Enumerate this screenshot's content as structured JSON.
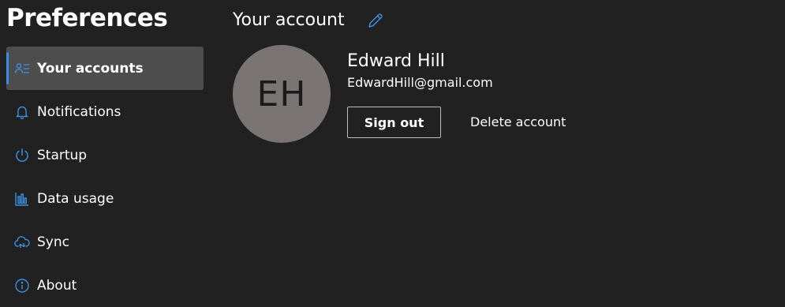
{
  "app": {
    "title": "Preferences"
  },
  "sidebar": {
    "items": [
      {
        "label": "Your accounts",
        "icon": "account-list-icon",
        "active": true
      },
      {
        "label": "Notifications",
        "icon": "bell-icon",
        "active": false
      },
      {
        "label": "Startup",
        "icon": "power-icon",
        "active": false
      },
      {
        "label": "Data usage",
        "icon": "bar-chart-icon",
        "active": false
      },
      {
        "label": "Sync",
        "icon": "cloud-sync-icon",
        "active": false
      },
      {
        "label": "About",
        "icon": "info-icon",
        "active": false
      }
    ]
  },
  "main": {
    "section_title": "Your account",
    "edit_icon": "pencil-icon",
    "account": {
      "initials": "EH",
      "name": "Edward Hill",
      "email": "EdwardHill@gmail.com"
    },
    "sign_out_label": "Sign out",
    "delete_label": "Delete account"
  },
  "colors": {
    "background": "#212121",
    "active_item_bg": "#4d4d4d",
    "accent": "#3a8fe0",
    "avatar_bg": "#7a7574"
  }
}
